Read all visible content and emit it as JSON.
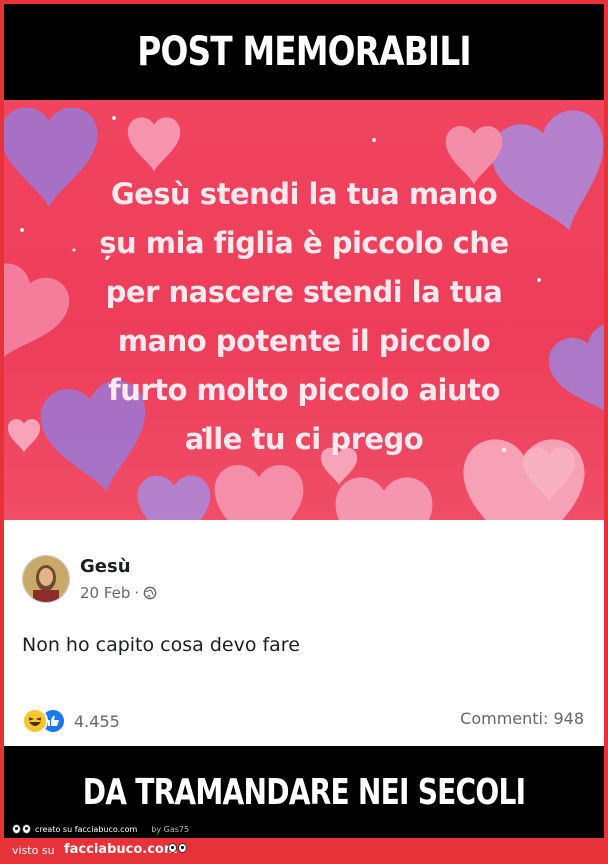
{
  "meme": {
    "top_caption": "POST MEMORABILI",
    "bottom_caption": "DA TRAMANDARE NEI SECOLI"
  },
  "image": {
    "quote_lines": [
      "Gesù stendi la tua mano",
      "șu mia figlia è piccolo che",
      "per nascere stendi la tua",
      "mano potente il piccolo",
      "furto molto piccolo aiuto",
      "alle tu ci prego"
    ]
  },
  "post": {
    "author": "Gesù",
    "date": "20 Feb",
    "separator": "·",
    "text": "Non ho capito cosa devo fare",
    "reaction_count": "4.455",
    "comments": "Commenti: 948",
    "icons": {
      "privacy": "globe-icon",
      "reactions": [
        "haha-reaction-icon",
        "like-reaction-icon"
      ]
    }
  },
  "credit": {
    "created": "creato su facciabuco.com",
    "by": "by Gas75"
  },
  "footer": {
    "seen_on": "visto su",
    "site": "facciabuco.com"
  },
  "colors": {
    "border": "#e8323a",
    "caption_bg": "#000000",
    "image_bg": "#ef4560",
    "quote_text": "#ffe9ef"
  }
}
